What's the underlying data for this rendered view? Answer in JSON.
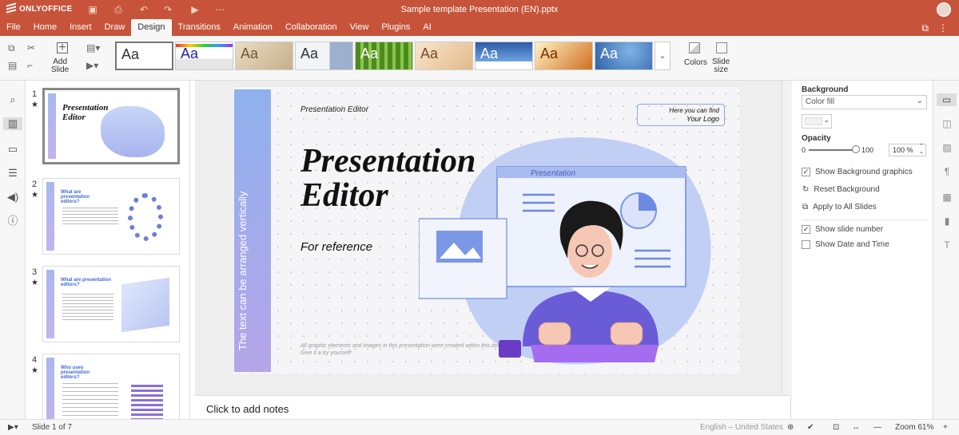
{
  "app": {
    "brand": "ONLYOFFICE",
    "doc_title": "Sample template Presentation (EN).pptx"
  },
  "titlebar_icons": [
    "save-icon",
    "print-icon",
    "undo-icon",
    "redo-icon",
    "play-icon",
    "more-icon"
  ],
  "menu": {
    "items": [
      "File",
      "Home",
      "Insert",
      "Draw",
      "Design",
      "Transitions",
      "Animation",
      "Collaboration",
      "View",
      "Plugins",
      "AI"
    ],
    "active": "Design"
  },
  "toolbar": {
    "add_slide": "Add\nSlide",
    "colors": "Colors",
    "slide_size": "Slide\nsize",
    "themes_label": "Aa"
  },
  "thumbnails": [
    {
      "num": "1",
      "title": "Presentation Editor"
    },
    {
      "num": "2",
      "title": "What are presentation editors?"
    },
    {
      "num": "3",
      "title": "What are presentation editors?"
    },
    {
      "num": "4",
      "title": "Who uses presentation editors?"
    }
  ],
  "slide": {
    "vertical_text": "The text can be arranged vertically",
    "small_title": "Presentation Editor",
    "big_title_line1": "Presentation",
    "big_title_line2": "Editor",
    "subtitle": "For reference",
    "logo_line1": "Here you can find",
    "logo_line2": "Your Logo",
    "illust_label": "Presentation",
    "disclaimer_line1": "All graphic elements and images in this presentation were created within this document.",
    "disclaimer_line2": "Give it a try yourself!"
  },
  "notes": {
    "placeholder": "Click to add notes"
  },
  "right_panel": {
    "background_label": "Background",
    "fill_value": "Color fill",
    "opacity_label": "Opacity",
    "opacity_min": "0",
    "opacity_max": "100",
    "opacity_value": "100 %",
    "opacity_level": 1.0,
    "show_bg_graphics": "Show Background graphics",
    "reset_bg": "Reset Background",
    "apply_all": "Apply to All Slides",
    "show_slide_number": "Show slide number",
    "show_date_time": "Show Date and Time"
  },
  "status": {
    "slide_of": "Slide 1 of 7",
    "language": "English – United States",
    "zoom": "Zoom 61%",
    "minus": "—",
    "plus": "+"
  },
  "colors": {
    "accent": "#c7543a",
    "slide_bar": "#8fb1ee",
    "illust_purple": "#6a5bd6"
  }
}
